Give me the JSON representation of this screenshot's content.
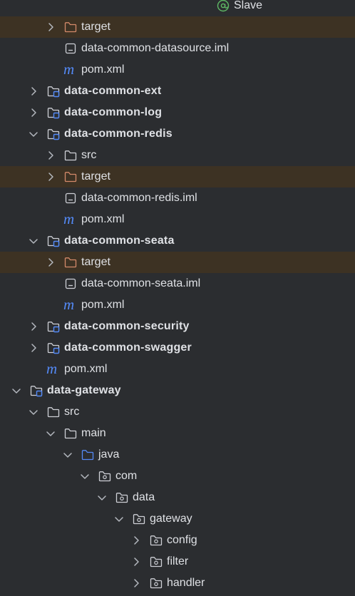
{
  "tree": [
    {
      "label": "Slave",
      "type": "annotation",
      "level": 11
    },
    {
      "label": "target",
      "type": "folder-excluded",
      "level": 2,
      "arrow": "collapsed",
      "excluded": true
    },
    {
      "label": "data-common-datasource.iml",
      "type": "iml",
      "level": 2
    },
    {
      "label": "pom.xml",
      "type": "maven",
      "level": 2
    },
    {
      "label": "data-common-ext",
      "type": "module",
      "level": 1,
      "arrow": "collapsed",
      "bold": true
    },
    {
      "label": "data-common-log",
      "type": "module",
      "level": 1,
      "arrow": "collapsed",
      "bold": true
    },
    {
      "label": "data-common-redis",
      "type": "module",
      "level": 1,
      "arrow": "expanded",
      "bold": true
    },
    {
      "label": "src",
      "type": "folder",
      "level": 2,
      "arrow": "collapsed"
    },
    {
      "label": "target",
      "type": "folder-excluded",
      "level": 2,
      "arrow": "collapsed",
      "excluded": true
    },
    {
      "label": "data-common-redis.iml",
      "type": "iml",
      "level": 2
    },
    {
      "label": "pom.xml",
      "type": "maven",
      "level": 2
    },
    {
      "label": "data-common-seata",
      "type": "module",
      "level": 1,
      "arrow": "expanded",
      "bold": true
    },
    {
      "label": "target",
      "type": "folder-excluded",
      "level": 2,
      "arrow": "collapsed",
      "excluded": true
    },
    {
      "label": "data-common-seata.iml",
      "type": "iml",
      "level": 2
    },
    {
      "label": "pom.xml",
      "type": "maven",
      "level": 2
    },
    {
      "label": "data-common-security",
      "type": "module",
      "level": 1,
      "arrow": "collapsed",
      "bold": true
    },
    {
      "label": "data-common-swagger",
      "type": "module",
      "level": 1,
      "arrow": "collapsed",
      "bold": true
    },
    {
      "label": "pom.xml",
      "type": "maven",
      "level": 1
    },
    {
      "label": "data-gateway",
      "type": "module",
      "level": 0,
      "arrow": "expanded",
      "bold": true
    },
    {
      "label": "src",
      "type": "folder",
      "level": 1,
      "arrow": "expanded"
    },
    {
      "label": "main",
      "type": "folder",
      "level": 2,
      "arrow": "expanded"
    },
    {
      "label": "java",
      "type": "folder-source",
      "level": 3,
      "arrow": "expanded"
    },
    {
      "label": "com",
      "type": "package",
      "level": 4,
      "arrow": "expanded"
    },
    {
      "label": "data",
      "type": "package",
      "level": 5,
      "arrow": "expanded"
    },
    {
      "label": "gateway",
      "type": "package",
      "level": 6,
      "arrow": "expanded"
    },
    {
      "label": "config",
      "type": "package",
      "level": 7,
      "arrow": "collapsed"
    },
    {
      "label": "filter",
      "type": "package",
      "level": 7,
      "arrow": "collapsed"
    },
    {
      "label": "handler",
      "type": "package",
      "level": 7,
      "arrow": "collapsed"
    }
  ],
  "colors": {
    "background": "#2b2d30",
    "excluded_row": "#3d3223",
    "text": "#dfe1e5",
    "icon_gray": "#ced0d6",
    "folder_excluded": "#d48a6a",
    "source_root": "#548af7",
    "maven_m": "#548af7",
    "annotation_green": "#5fb865",
    "chevron": "#b4b8bf"
  }
}
